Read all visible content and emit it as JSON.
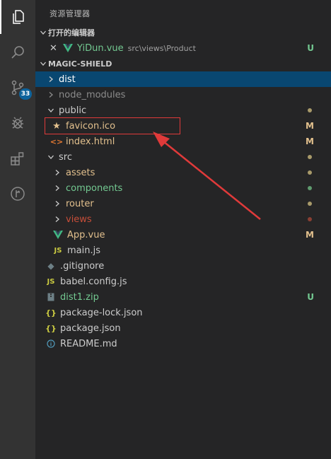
{
  "activity_bar": {
    "items": [
      {
        "name": "explorer-icon",
        "active": true
      },
      {
        "name": "search-icon"
      },
      {
        "name": "source-control-icon",
        "badge": "33"
      },
      {
        "name": "debug-icon"
      },
      {
        "name": "extensions-icon"
      },
      {
        "name": "remote-icon"
      }
    ]
  },
  "sidebar": {
    "title": "资源管理器",
    "open_editors": {
      "header": "打开的编辑器",
      "items": [
        {
          "name": "YiDun.vue",
          "path": "src\\views\\Product",
          "decoration": "U"
        }
      ]
    },
    "project": {
      "header": "MAGIC-SHIELD",
      "items": [
        {
          "label": "dist",
          "kind": "folder",
          "expanded": false,
          "selected": true
        },
        {
          "label": "node_modules",
          "kind": "folder",
          "expanded": false,
          "dimmed": true
        },
        {
          "label": "public",
          "kind": "folder",
          "expanded": true
        },
        {
          "label": "favicon.ico",
          "kind": "file",
          "decoration": "M"
        },
        {
          "label": "index.html",
          "kind": "file",
          "decoration": "M"
        },
        {
          "label": "src",
          "kind": "folder",
          "expanded": true
        },
        {
          "label": "assets",
          "kind": "folder"
        },
        {
          "label": "components",
          "kind": "folder"
        },
        {
          "label": "router",
          "kind": "folder"
        },
        {
          "label": "views",
          "kind": "folder"
        },
        {
          "label": "App.vue",
          "kind": "file",
          "decoration": "M"
        },
        {
          "label": "main.js",
          "kind": "file"
        },
        {
          "label": ".gitignore",
          "kind": "file"
        },
        {
          "label": "babel.config.js",
          "kind": "file"
        },
        {
          "label": "dist1.zip",
          "kind": "file",
          "decoration": "U"
        },
        {
          "label": "package-lock.json",
          "kind": "file"
        },
        {
          "label": "package.json",
          "kind": "file"
        },
        {
          "label": "README.md",
          "kind": "file"
        }
      ]
    }
  },
  "colors": {
    "modified": "#e2c08d",
    "untracked": "#73c991",
    "error": "#c74e39",
    "annotation": "#e03a3a"
  }
}
